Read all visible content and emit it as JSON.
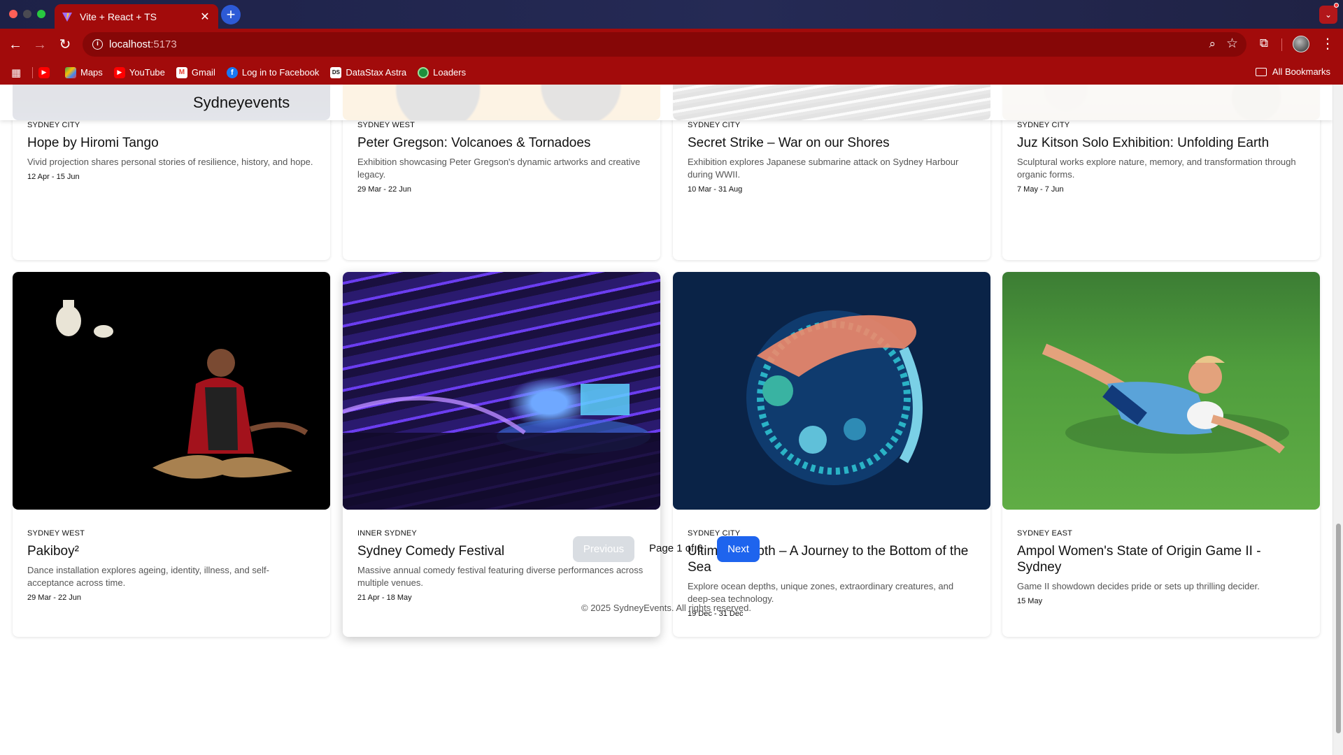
{
  "browser": {
    "tab_title": "Vite + React + TS",
    "url_host": "localhost",
    "url_port": ":5173",
    "bookmarks": [
      {
        "label": "",
        "icon": "youtube-icon"
      },
      {
        "label": "Maps",
        "icon": "maps-icon"
      },
      {
        "label": "YouTube",
        "icon": "youtube-icon"
      },
      {
        "label": "Gmail",
        "icon": "gmail-icon"
      },
      {
        "label": "Log in to Facebook",
        "icon": "facebook-icon"
      },
      {
        "label": "DataStax Astra",
        "icon": "datastax-icon"
      },
      {
        "label": "Loaders",
        "icon": "loaders-icon"
      }
    ],
    "all_bookmarks": "All Bookmarks",
    "accent": "#a20b0b"
  },
  "site": {
    "logo": "Sydneyevents",
    "footer": "© 2025 SydneyEvents. All rights reserved."
  },
  "events_row1": [
    {
      "region": "SYDNEY CITY",
      "title": "Hope by Hiromi Tango",
      "desc": "Vivid projection shares personal stories of resilience, history, and hope.",
      "date": "12 Apr - 15 Jun"
    },
    {
      "region": "SYDNEY WEST",
      "title": "Peter Gregson: Volcanoes & Tornadoes",
      "desc": "Exhibition showcasing Peter Gregson's dynamic artworks and creative legacy.",
      "date": "29 Mar - 22 Jun"
    },
    {
      "region": "SYDNEY CITY",
      "title": "Secret Strike – War on our Shores",
      "desc": "Exhibition explores Japanese submarine attack on Sydney Harbour during WWII.",
      "date": "10 Mar - 31 Aug"
    },
    {
      "region": "SYDNEY CITY",
      "title": "Juz Kitson Solo Exhibition: Unfolding Earth",
      "desc": "Sculptural works explore nature, memory, and transformation through organic forms.",
      "date": "7 May - 7 Jun"
    }
  ],
  "events_row2": [
    {
      "region": "SYDNEY WEST",
      "title": "Pakiboy²",
      "desc": "Dance installation explores ageing, identity, illness, and self-acceptance across time.",
      "date": "29 Mar - 22 Jun"
    },
    {
      "region": "INNER SYDNEY",
      "title": "Sydney Comedy Festival",
      "desc": "Massive annual comedy festival featuring diverse performances across multiple venues.",
      "date": "21 Apr - 18 May"
    },
    {
      "region": "SYDNEY CITY",
      "title": "Ultimate Depth – A Journey to the Bottom of the Sea",
      "desc": "Explore ocean depths, unique zones, extraordinary creatures, and deep-sea technology.",
      "date": "19 Dec - 31 Dec"
    },
    {
      "region": "SYDNEY EAST",
      "title": "Ampol Women's State of Origin Game II - Sydney",
      "desc": "Game II showdown decides pride or sets up thrilling decider.",
      "date": "15 May"
    }
  ],
  "pagination": {
    "previous": "Previous",
    "page_info": "Page 1 of 6",
    "next": "Next",
    "current_page": 1,
    "total_pages": 6
  }
}
